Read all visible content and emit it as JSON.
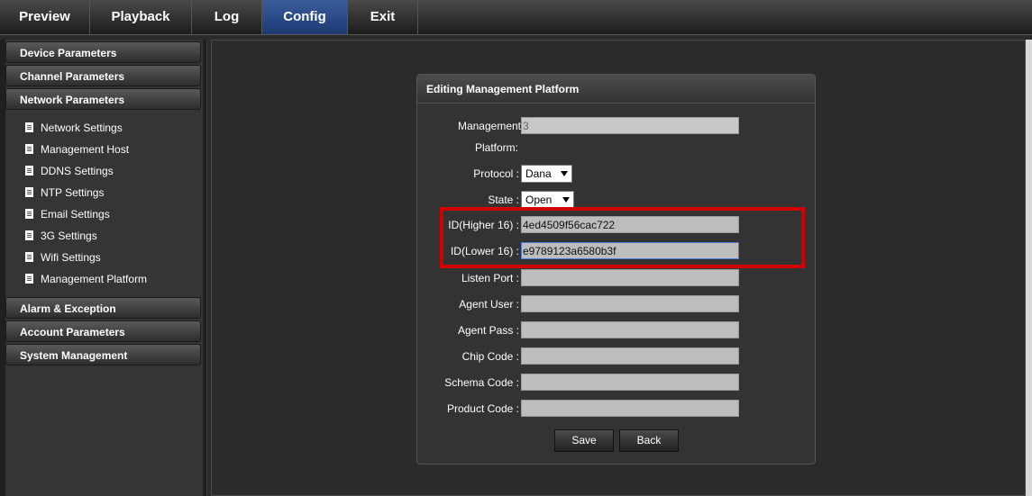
{
  "tabs": [
    "Preview",
    "Playback",
    "Log",
    "Config",
    "Exit"
  ],
  "active_tab": "Config",
  "sidebar": {
    "sections_top": [
      "Device Parameters",
      "Channel Parameters",
      "Network Parameters"
    ],
    "network_items": [
      "Network Settings",
      "Management Host",
      "DDNS Settings",
      "NTP Settings",
      "Email Settings",
      "3G Settings",
      "Wifi Settings",
      "Management Platform"
    ],
    "sections_bottom": [
      "Alarm & Exception",
      "Account Parameters",
      "System Management"
    ]
  },
  "panel": {
    "title": "Editing Management Platform",
    "management_label_1": "Management",
    "management_label_2": "Platform:",
    "management_value": "3",
    "protocol_label": "Protocol :",
    "protocol_value": "Dana",
    "state_label": "State :",
    "state_value": "Open",
    "id_higher_label": "ID(Higher 16) :",
    "id_higher_value": "4ed4509f56cac722",
    "id_lower_label": "ID(Lower 16) :",
    "id_lower_value": "e9789123a6580b3f",
    "listen_port_label": "Listen Port :",
    "listen_port_value": "",
    "agent_user_label": "Agent User :",
    "agent_user_value": "",
    "agent_pass_label": "Agent Pass :",
    "agent_pass_value": "",
    "chip_code_label": "Chip Code :",
    "chip_code_value": "",
    "schema_code_label": "Schema Code :",
    "schema_code_value": "",
    "product_code_label": "Product Code :",
    "product_code_value": "",
    "save_label": "Save",
    "back_label": "Back"
  },
  "colors": {
    "highlight": "#d00000",
    "active_tab": "#2a4a86"
  }
}
